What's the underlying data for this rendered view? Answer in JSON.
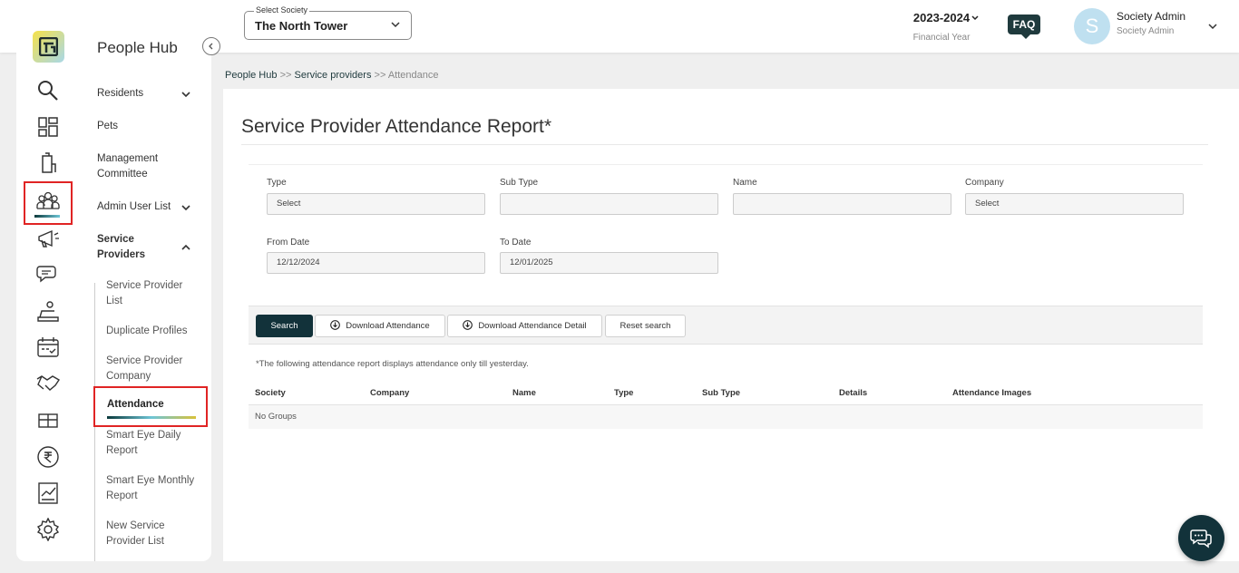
{
  "header": {
    "society_label": "Select Society",
    "society_value": "The North Tower",
    "financial_year": "2023-2024",
    "financial_year_caption": "Financial Year",
    "faq_label": "FAQ",
    "avatar_initial": "S",
    "user_name": "Society Admin",
    "user_role": "Society Admin"
  },
  "rail": {
    "icons": [
      "app-logo-icon",
      "search-icon",
      "dashboard-grid-icon",
      "building-icon",
      "people-hub-icon",
      "announcement-icon",
      "messages-icon",
      "helpdesk-icon",
      "calendar-icon",
      "handshake-icon",
      "amenities-icon",
      "rupee-icon",
      "reports-icon",
      "settings-icon"
    ],
    "active": "people-hub-icon"
  },
  "sidebar": {
    "title": "People Hub",
    "items": [
      {
        "label": "Residents",
        "expandable": true
      },
      {
        "label": "Pets"
      },
      {
        "label": "Management Committee"
      },
      {
        "label": "Admin User List",
        "expandable": true
      },
      {
        "label": "Service Providers",
        "expanded": true
      }
    ],
    "sub_items": [
      {
        "label": "Service Provider List"
      },
      {
        "label": "Duplicate Profiles"
      },
      {
        "label": "Service Provider Company"
      },
      {
        "label": "Attendance",
        "active": true
      },
      {
        "label": "Smart Eye Daily Report"
      },
      {
        "label": "Smart Eye Monthly Report"
      },
      {
        "label": "New Service Provider List"
      }
    ]
  },
  "breadcrumb": {
    "part1": "People Hub",
    "sep1": ">>",
    "part2": "Service providers",
    "sep2": ">>",
    "part3": "Attendance"
  },
  "page_title": "Service Provider Attendance Report*",
  "filters": {
    "type_label": "Type",
    "type_value": "Select",
    "subtype_label": "Sub Type",
    "subtype_value": "",
    "name_label": "Name",
    "name_value": "",
    "company_label": "Company",
    "company_value": "Select",
    "from_label": "From Date",
    "from_value": "12/12/2024",
    "to_label": "To Date",
    "to_value": "12/01/2025"
  },
  "actions": {
    "search": "Search",
    "download_attendance": "Download Attendance",
    "download_detail": "Download Attendance Detail",
    "reset": "Reset search"
  },
  "note": "*The following attendance report displays attendance only till yesterday.",
  "table": {
    "columns": [
      "Society",
      "Company",
      "Name",
      "Type",
      "Sub Type",
      "Details",
      "Attendance Images"
    ],
    "empty_text": "No Groups"
  },
  "colors": {
    "accent": "#12323a",
    "highlight": "#e02424"
  }
}
